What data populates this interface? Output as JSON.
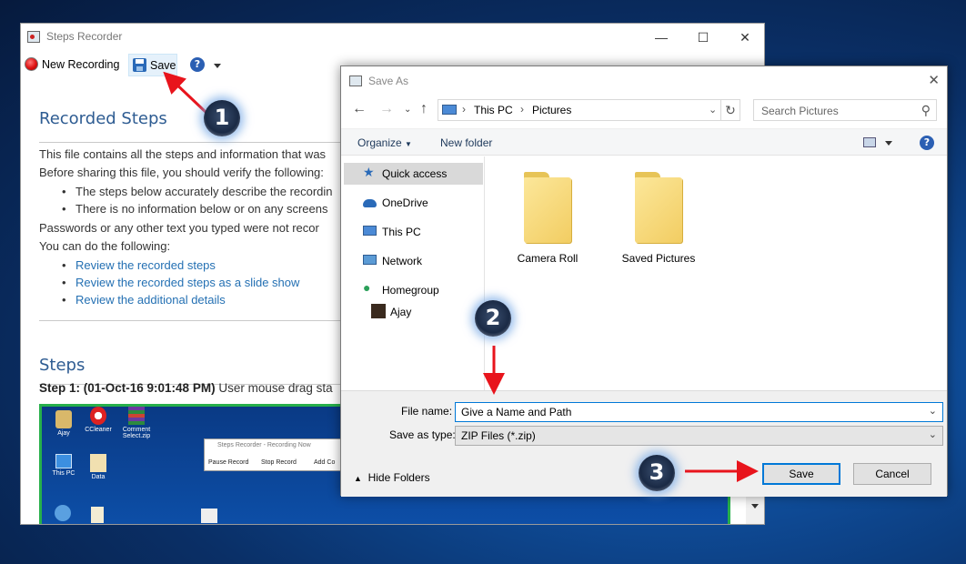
{
  "steps_recorder": {
    "title": "Steps Recorder",
    "toolbar": {
      "new_recording": "New Recording",
      "save": "Save"
    },
    "heading": "Recorded Steps",
    "p1": "This file contains all the steps and information that was",
    "p2": "Before sharing this file, you should verify the following:",
    "bullet1": "The steps below accurately describe the recordin",
    "bullet2": "There is no information below or on any screens",
    "p3": "Passwords or any other text you typed were not recor",
    "p4": "You can do the following:",
    "links": [
      "Review the recorded steps",
      "Review the recorded steps as a slide show",
      "Review the additional details"
    ],
    "steps_heading": "Steps",
    "step1_label": "Step 1: (01-Oct-16 9:01:48 PM)",
    "step1_text": "User mouse drag sta",
    "embedded": {
      "icons": [
        "Ajay",
        "CCleaner",
        "Comment Select.zip",
        "This PC",
        "Data"
      ],
      "mini_title": "Steps Recorder - Recording Now",
      "mini_buttons": [
        "Pause Record",
        "Stop Record",
        "Add Co"
      ]
    }
  },
  "save_as": {
    "title": "Save As",
    "address": [
      "This PC",
      "Pictures"
    ],
    "search_placeholder": "Search Pictures",
    "commands": {
      "organize": "Organize",
      "new_folder": "New folder"
    },
    "nav_items": [
      "Quick access",
      "OneDrive",
      "This PC",
      "Network",
      "Homegroup",
      "Ajay"
    ],
    "folders": [
      "Camera Roll",
      "Saved Pictures"
    ],
    "file_name_label": "File name:",
    "file_name_value": "Give a Name and Path",
    "save_type_label": "Save as type:",
    "save_type_value": "ZIP Files (*.zip)",
    "hide_folders": "Hide Folders",
    "save_button": "Save",
    "cancel_button": "Cancel"
  },
  "annotations": [
    "1",
    "2",
    "3"
  ],
  "colors": {
    "annotation_arrow": "#e8141c",
    "link": "#2470b3",
    "heading": "#2e5c92",
    "highlight_border": "#27b04b"
  }
}
